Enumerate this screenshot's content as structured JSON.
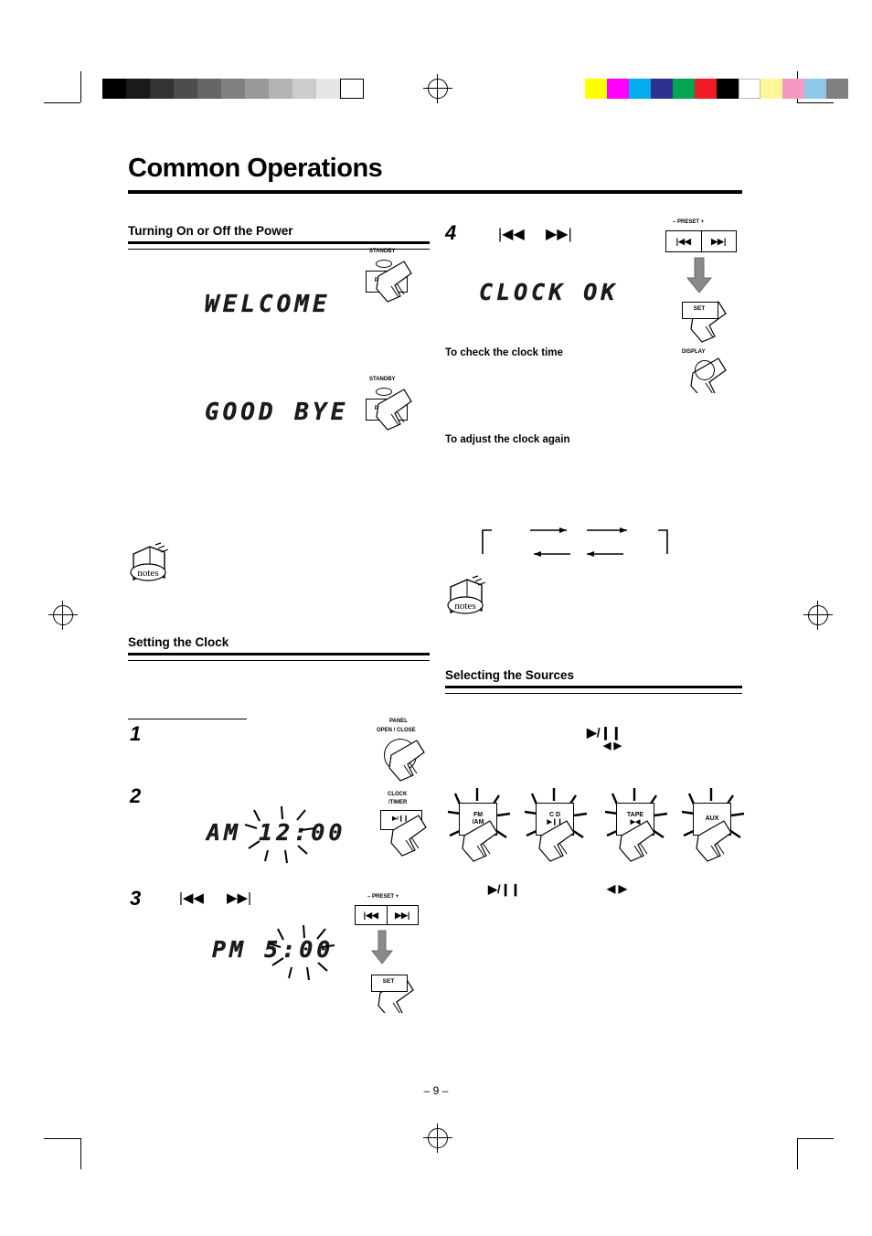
{
  "page": {
    "number": "– 9 –",
    "title": "Common Operations"
  },
  "sections": {
    "power": {
      "title": "Turning On or Off the Power",
      "display_on": "WELCOME",
      "display_off": "GOOD BYE",
      "standby_label": "STANDBY",
      "power_label": "POWER"
    },
    "clock": {
      "title": "Setting the Clock",
      "steps": [
        "1",
        "2",
        "3",
        "4"
      ],
      "display_am": "AM 12:00",
      "display_pm": "PM 5:00",
      "display_ok": "CLOCK OK",
      "panel_label_line1": "PANEL",
      "panel_label_line2": "OPEN / CLOSE",
      "clock_timer_line1": "CLOCK",
      "clock_timer_line2": "/TIMER",
      "clock_timer_line3": "▶/❙❙",
      "preset_minus": "– PRESET +",
      "preset_left": "▶▶|",
      "preset_right": "|◀◀",
      "set_label": "SET",
      "display_button_label": "DISPLAY",
      "to_check": "To check the clock time",
      "to_adjust": "To adjust the clock again",
      "skip_back": "|◀◀",
      "skip_fwd": "▶▶|"
    },
    "sources": {
      "title": "Selecting the Sources",
      "play_pause": "▶/❙❙",
      "left_right": "◀ ▶",
      "buttons": [
        {
          "line1": "FM",
          "line2": "/AM"
        },
        {
          "line1": "C D",
          "line2": "▶❙❙"
        },
        {
          "line1": "TAPE",
          "line2": "▶◀"
        },
        {
          "line1": "AUX",
          "line2": ""
        }
      ],
      "bottom_play": "▶/❙❙",
      "bottom_lr": "◀ ▶"
    },
    "notes_label": "notes"
  },
  "colors": {
    "ink": "#000000",
    "grayscale": [
      "#000000",
      "#1a1a1a",
      "#333333",
      "#4d4d4d",
      "#666666",
      "#808080",
      "#999999",
      "#b3b3b3",
      "#cccccc",
      "#e6e6e6",
      "#ffffff"
    ],
    "colorbar": [
      "#ffff00",
      "#ff00ff",
      "#00aeef",
      "#2e3192",
      "#00a651",
      "#ed1c24",
      "#000000",
      "#ffffff",
      "#fff799",
      "#f49ac1",
      "#8dc8e8",
      "#808080"
    ]
  }
}
